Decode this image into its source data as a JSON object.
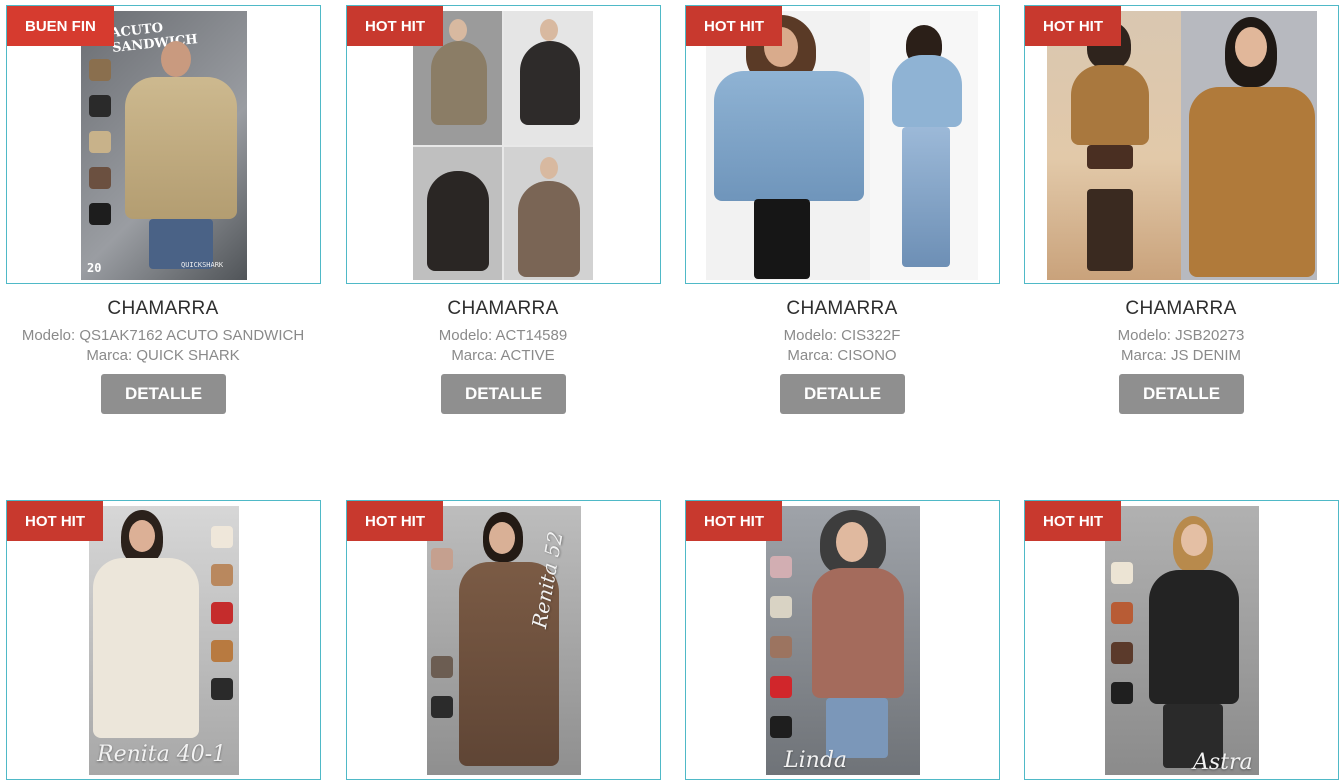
{
  "products": [
    {
      "badge": "BUEN FIN",
      "title": "CHAMARRA",
      "model": "Modelo: QS1AK7162 ACUTO SANDWICH",
      "brand": "Marca: QUICK SHARK",
      "button": "DETALLE",
      "photo_text": "ACUTO SANDWICH",
      "photo_sub": "QUICKSHARK",
      "photo_count": "20"
    },
    {
      "badge": "HOT HIT",
      "title": "CHAMARRA",
      "model": "Modelo: ACT14589",
      "brand": "Marca: ACTIVE",
      "button": "DETALLE"
    },
    {
      "badge": "HOT HIT",
      "title": "CHAMARRA",
      "model": "Modelo: CIS322F",
      "brand": "Marca: CISONO",
      "button": "DETALLE"
    },
    {
      "badge": "HOT HIT",
      "title": "CHAMARRA",
      "model": "Modelo: JSB20273",
      "brand": "Marca: JS DENIM",
      "button": "DETALLE"
    },
    {
      "badge": "HOT HIT",
      "photo_text": "Renita 40-1"
    },
    {
      "badge": "HOT HIT",
      "photo_text": "Renita 52"
    },
    {
      "badge": "HOT HIT",
      "photo_text": "Linda"
    },
    {
      "badge": "HOT HIT",
      "photo_text": "Astra"
    }
  ],
  "colors": {
    "badge_red": "#d63b2f",
    "border_teal": "#4fb9c7",
    "button_gray": "#8f8f8f"
  }
}
